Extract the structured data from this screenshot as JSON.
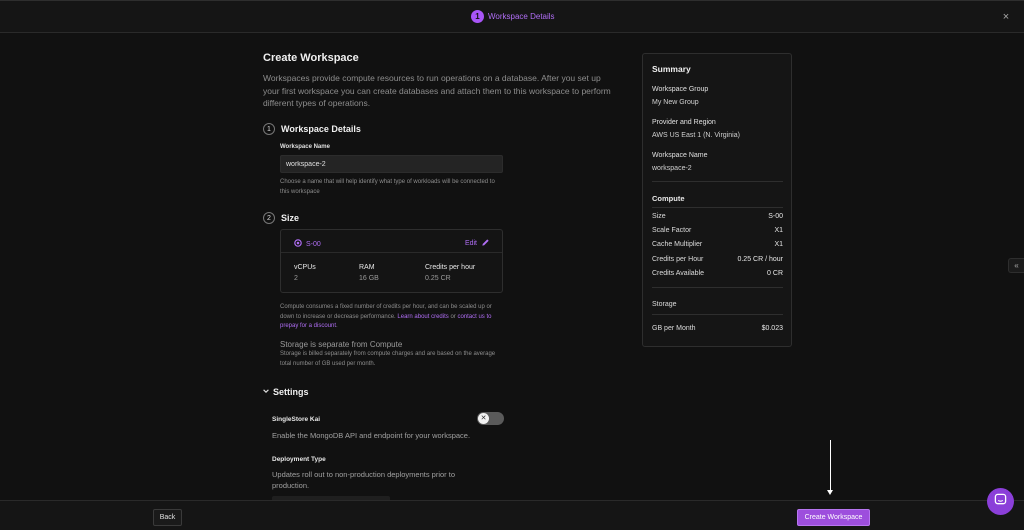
{
  "topbar": {
    "step_number": "1",
    "step_title": "Workspace Details",
    "close_label": "×"
  },
  "main": {
    "title": "Create Workspace",
    "description": "Workspaces provide compute resources to run operations on a database. After you set up your first workspace you can create databases and attach them to this workspace to perform different types of operations."
  },
  "details": {
    "number": "1",
    "heading": "Workspace Details",
    "field_label": "Workspace Name",
    "field_value": "workspace-2",
    "hint": "Choose a name that will help identify what type of workloads will be connected to this workspace"
  },
  "size": {
    "number": "2",
    "heading": "Size",
    "selected": "S-00",
    "edit_label": "Edit",
    "specs": [
      {
        "label": "vCPUs",
        "value": "2"
      },
      {
        "label": "RAM",
        "value": "16 GB"
      },
      {
        "label": "Credits per hour",
        "value": "0.25 CR"
      }
    ],
    "compute_note_pre": "Compute consumes a fixed number of credits per hour, and can be scaled up or down to increase or decrease performance. ",
    "learn_link": "Learn about credits",
    "compute_note_mid": " or ",
    "contact_link": "contact us to prepay for a discount",
    "compute_note_end": ".",
    "storage_title": "Storage is separate from Compute",
    "storage_note": "Storage is billed separately from compute charges and are based on the average total number of GB used per month."
  },
  "settings": {
    "heading": "Settings",
    "kai_label": "SingleStore Kai",
    "kai_desc": "Enable the MongoDB API and endpoint for your workspace.",
    "deploy_label": "Deployment Type",
    "deploy_desc": "Updates roll out to non-production deployments prior to production."
  },
  "summary": {
    "title": "Summary",
    "group_label": "Workspace Group",
    "group_value": "My New Group",
    "region_label": "Provider and Region",
    "region_value": "AWS US East 1 (N. Virginia)",
    "name_label": "Workspace Name",
    "name_value": "workspace-2",
    "compute_heading": "Compute",
    "compute_rows": [
      {
        "label": "Size",
        "value": "S-00"
      },
      {
        "label": "Scale Factor",
        "value": "X1"
      },
      {
        "label": "Cache Multiplier",
        "value": "X1"
      },
      {
        "label": "Credits per Hour",
        "value": "0.25 CR / hour"
      },
      {
        "label": "Credits Available",
        "value": "0 CR"
      }
    ],
    "storage_heading": "Storage",
    "storage_row": {
      "label": "GB per Month",
      "value": "$0.023"
    }
  },
  "footer": {
    "back_label": "Back",
    "create_label": "Create Workspace"
  },
  "colors": {
    "accent": "#a855f7",
    "button": "#9d4edd",
    "background": "#111111"
  }
}
